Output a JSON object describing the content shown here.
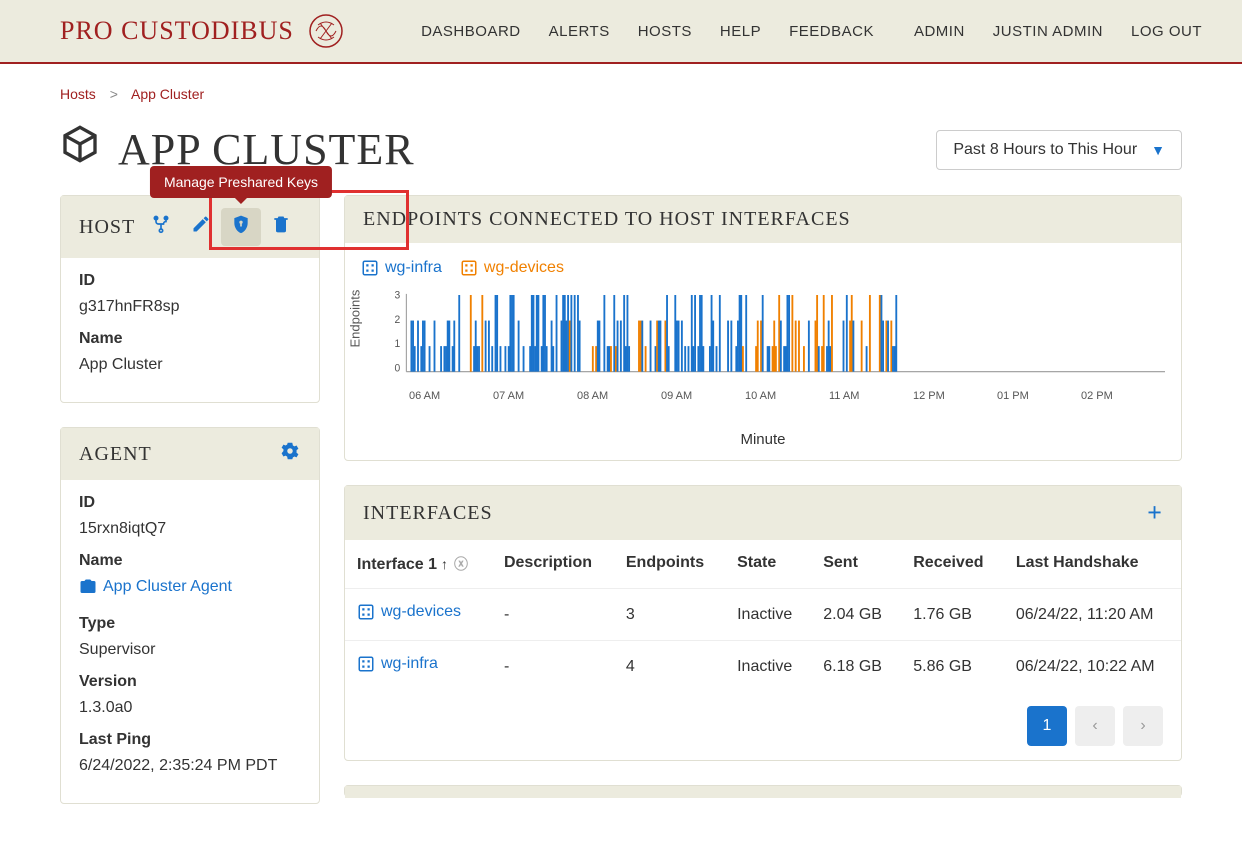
{
  "brand": "PRO CUSTODIBUS",
  "nav": {
    "dashboard": "DASHBOARD",
    "alerts": "ALERTS",
    "hosts": "HOSTS",
    "help": "HELP",
    "feedback": "FEEDBACK",
    "admin": "ADMIN",
    "user": "JUSTIN ADMIN",
    "logout": "LOG OUT"
  },
  "breadcrumb": {
    "root": "Hosts",
    "current": "App Cluster"
  },
  "page_title": "APP CLUSTER",
  "time_range": "Past 8 Hours to This Hour",
  "tooltip": "Manage Preshared Keys",
  "host_panel": {
    "title": "HOST",
    "id_label": "ID",
    "id_value": "g317hnFR8sp",
    "name_label": "Name",
    "name_value": "App Cluster"
  },
  "agent_panel": {
    "title": "AGENT",
    "id_label": "ID",
    "id_value": "15rxn8iqtQ7",
    "name_label": "Name",
    "name_value": "App Cluster Agent",
    "type_label": "Type",
    "type_value": "Supervisor",
    "version_label": "Version",
    "version_value": "1.3.0a0",
    "lastping_label": "Last Ping",
    "lastping_value": "6/24/2022, 2:35:24 PM PDT"
  },
  "endpoints_panel": {
    "title": "ENDPOINTS CONNECTED TO HOST INTERFACES",
    "series1": "wg-infra",
    "series2": "wg-devices"
  },
  "chart_data": {
    "type": "bar",
    "title": "Endpoints Connected to Host Interfaces",
    "xlabel": "Minute",
    "ylabel": "Endpoints",
    "ylim": [
      0,
      3
    ],
    "yticks": [
      0,
      1,
      2,
      3
    ],
    "xticks": [
      "06 AM",
      "07 AM",
      "08 AM",
      "09 AM",
      "10 AM",
      "11 AM",
      "12 PM",
      "01 PM",
      "02 PM"
    ],
    "series": [
      {
        "name": "wg-infra",
        "color": "#1a73cc",
        "note": "per-minute endpoint counts 0–3, dense between 06 AM and ~11 AM, sparse after"
      },
      {
        "name": "wg-devices",
        "color": "#f08000",
        "note": "per-minute endpoint counts 0–3, intermittent through morning, cluster around 10–11 AM"
      }
    ]
  },
  "interfaces_panel": {
    "title": "INTERFACES",
    "headers": {
      "interface": "Interface 1",
      "description": "Description",
      "endpoints": "Endpoints",
      "state": "State",
      "sent": "Sent",
      "received": "Received",
      "handshake": "Last Handshake"
    },
    "rows": [
      {
        "iface": "wg-devices",
        "desc": "-",
        "endpoints": "3",
        "state": "Inactive",
        "sent": "2.04 GB",
        "received": "1.76 GB",
        "handshake": "06/24/22, 11:20 AM"
      },
      {
        "iface": "wg-infra",
        "desc": "-",
        "endpoints": "4",
        "state": "Inactive",
        "sent": "6.18 GB",
        "received": "5.86 GB",
        "handshake": "06/24/22, 10:22 AM"
      }
    ]
  },
  "pagination": {
    "current": "1"
  }
}
